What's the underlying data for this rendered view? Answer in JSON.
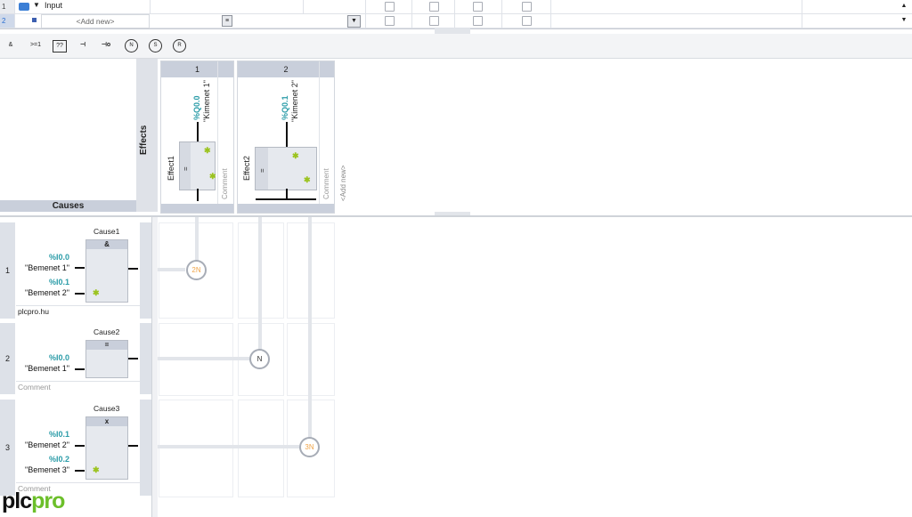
{
  "var_table": {
    "rows": [
      {
        "num": "1",
        "name": "Input"
      },
      {
        "num": "2",
        "name": "<Add new>"
      }
    ]
  },
  "toolbar": {
    "items": [
      "&",
      ">=1",
      "??",
      "⊣",
      "⊣o",
      "N",
      "S",
      "R"
    ]
  },
  "causes_header": "Causes",
  "effects_label": "Effects",
  "effects": [
    {
      "num": "1",
      "name": "Effect1",
      "address": "%Q0.0",
      "signal": "\"Kimenet 1\"",
      "box": "=",
      "comment": "Comment"
    },
    {
      "num": "2",
      "name": "Effect2",
      "address": "%Q0.1",
      "signal": "\"Kimenet 2\"",
      "box": "=",
      "comment": "Comment"
    }
  ],
  "add_new_effect": "<Add new>",
  "causes": [
    {
      "num": "1",
      "name": "Cause1",
      "op": "&",
      "inputs": [
        {
          "address": "%I0.0",
          "signal": "\"Bemenet 1\""
        },
        {
          "address": "%I0.1",
          "signal": "\"Bemenet 2\""
        }
      ],
      "comment": "plcpro.hu"
    },
    {
      "num": "2",
      "name": "Cause2",
      "op": "=",
      "inputs": [
        {
          "address": "%I0.0",
          "signal": "\"Bemenet 1\""
        }
      ],
      "comment": "Comment"
    },
    {
      "num": "3",
      "name": "Cause3",
      "op": "x",
      "inputs": [
        {
          "address": "%I0.1",
          "signal": "\"Bemenet 2\""
        },
        {
          "address": "%I0.2",
          "signal": "\"Bemenet 3\""
        }
      ],
      "comment": "Comment"
    }
  ],
  "intersections": [
    "2N",
    "N",
    "3N"
  ],
  "logo": {
    "part1": "plc",
    "part2": "pro",
    "color1": "#111111",
    "color2": "#6cbf2a"
  },
  "colors": {
    "address": "#2b9ca8",
    "star": "#9bc31e",
    "node_orange": "#f0a54a"
  }
}
